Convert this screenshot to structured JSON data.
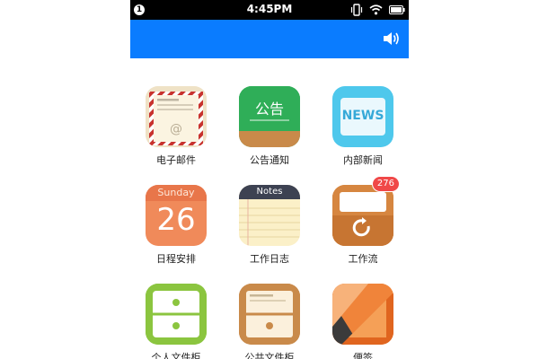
{
  "status_bar": {
    "badge": "1",
    "time": "4:45PM"
  },
  "apps": [
    {
      "label": "电子邮件",
      "icon": "mail-icon"
    },
    {
      "label": "公告通知",
      "icon": "announcement-board-icon",
      "icon_text": "公告"
    },
    {
      "label": "内部新闻",
      "icon": "news-icon",
      "icon_text": "NEWS"
    },
    {
      "label": "日程安排",
      "icon": "calendar-icon",
      "weekday": "Sunday",
      "day": "26"
    },
    {
      "label": "工作日志",
      "icon": "notes-icon",
      "icon_text": "Notes"
    },
    {
      "label": "工作流",
      "icon": "workflow-icon",
      "badge": "276"
    },
    {
      "label": "个人文件柜",
      "icon": "cabinet-green-icon"
    },
    {
      "label": "公共文件柜",
      "icon": "cabinet-brown-icon"
    },
    {
      "label": "便签",
      "icon": "sticky-notes-icon"
    }
  ],
  "colors": {
    "app_bar": "#0a7cff",
    "status_bar": "#000000",
    "badge": "#f04848"
  }
}
